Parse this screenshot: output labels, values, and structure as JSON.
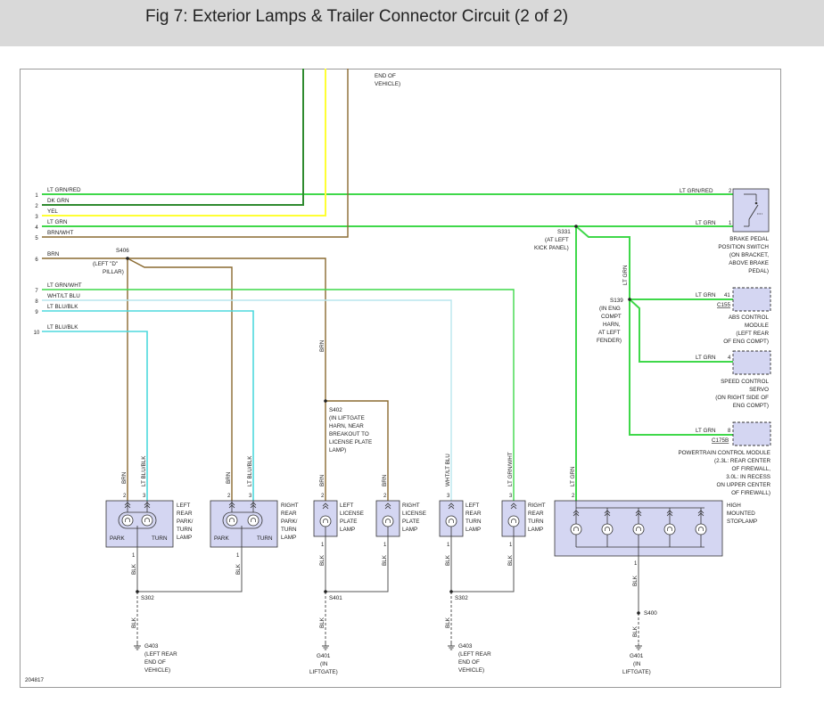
{
  "title": "Fig 7: Exterior Lamps & Trailer Connector Circuit (2 of 2)",
  "figure_number": "204817",
  "colors": {
    "lt_grn": "#3fd84a",
    "dk_grn": "#2f8a2f",
    "yel": "#ffff33",
    "brn": "#8a6a30",
    "lt_blu": "#4ed8de",
    "wht_lt_blu": "#b9e6ee",
    "box_fill": "#d4d6f2"
  },
  "top_note": {
    "line1": "END OF",
    "line2": "VEHICLE)"
  },
  "wires": [
    {
      "pin": "1",
      "color": "LT GRN/RED"
    },
    {
      "pin": "2",
      "color": "DK GRN"
    },
    {
      "pin": "3",
      "color": "YEL"
    },
    {
      "pin": "4",
      "color": "LT GRN"
    },
    {
      "pin": "5",
      "color": "BRN/WHT"
    },
    {
      "pin": "6",
      "color": "BRN"
    },
    {
      "pin": "7",
      "color": "LT GRN/WHT"
    },
    {
      "pin": "8",
      "color": "WHT/LT BLU"
    },
    {
      "pin": "9",
      "color": "LT BLU/BLK"
    },
    {
      "pin": "10",
      "color": "LT BLU/BLK"
    }
  ],
  "splices": {
    "s406": {
      "name": "S406",
      "l1": "(LEFT \"D\"",
      "l2": "PILLAR)"
    },
    "s331": {
      "name": "S331",
      "l1": "(AT LEFT",
      "l2": "KICK PANEL)"
    },
    "s139": {
      "name": "S139",
      "l1": "(IN ENG",
      "l2": "COMPT",
      "l3": "HARN,",
      "l4": "AT LEFT",
      "l5": "FENDER)"
    },
    "s402": {
      "name": "S402",
      "l1": "(IN LIFTGATE",
      "l2": "HARN, NEAR",
      "l3": "BREAKOUT TO",
      "l4": "LICENSE PLATE",
      "l5": "LAMP)"
    },
    "s302a": "S302",
    "s302b": "S302",
    "s401": "S401",
    "s400": "S400"
  },
  "brake_switch": {
    "wire1": "LT GRN/RED",
    "pin1": "2",
    "wire2": "LT GRN",
    "pin2": "1",
    "l1": "BRAKE PEDAL",
    "l2": "POSITION SWITCH",
    "l3": "(ON BRACKET,",
    "l4": "ABOVE BRAKE",
    "l5": "PEDAL)"
  },
  "abs": {
    "wire": "LT GRN",
    "pin": "41",
    "conn": "C155",
    "l1": "ABS CONTROL",
    "l2": "MODULE",
    "l3": "(LEFT REAR",
    "l4": "OF ENG COMPT)"
  },
  "speed": {
    "wire": "LT GRN",
    "pin": "4",
    "l1": "SPEED CONTROL",
    "l2": "SERVO",
    "l3": "(ON RIGHT SIDE OF",
    "l4": "ENG COMPT)"
  },
  "pcm": {
    "wire": "LT GRN",
    "pin": "8",
    "conn": "C175B",
    "l1": "POWERTRAIN CONTROL MODULE",
    "l2": "(2.3L: REAR CENTER",
    "l3": "OF FIREWALL,",
    "l4": "3.0L: IN RECESS",
    "l5": "ON UPPER CENTER",
    "l6": "OF FIREWALL)"
  },
  "vert_labels": {
    "lt_grn": "LT GRN",
    "brn": "BRN",
    "brn1": "BRN",
    "ltblublk1": "LT BLU/BLK",
    "brn2": "BRN",
    "ltblublk2": "LT BLU/BLK",
    "brn3": "BRN",
    "brn4": "BRN",
    "wht_lt_blu": "WHT/LT BLU",
    "lt_grn_wht": "LT GRN/WHT",
    "lt_grn2": "LT GRN",
    "blk": "BLK"
  },
  "lamps": {
    "lrp": {
      "l1": "LEFT",
      "l2": "REAR",
      "l3": "PARK/",
      "l4": "TURN",
      "l5": "LAMP",
      "park": "PARK",
      "turn": "TURN"
    },
    "rrp": {
      "l1": "RIGHT",
      "l2": "REAR",
      "l3": "PARK/",
      "l4": "TURN",
      "l5": "LAMP",
      "park": "PARK",
      "turn": "TURN"
    },
    "llp": {
      "l1": "LEFT",
      "l2": "LICENSE",
      "l3": "PLATE",
      "l4": "LAMP"
    },
    "rlp": {
      "l1": "RIGHT",
      "l2": "LICENSE",
      "l3": "PLATE",
      "l4": "LAMP"
    },
    "lrt": {
      "l1": "LEFT",
      "l2": "REAR",
      "l3": "TURN",
      "l4": "LAMP"
    },
    "rrt": {
      "l1": "RIGHT",
      "l2": "REAR",
      "l3": "TURN",
      "l4": "LAMP"
    },
    "hms": {
      "l1": "HIGH",
      "l2": "MOUNTED",
      "l3": "STOPLAMP"
    }
  },
  "grounds": {
    "g403a": {
      "name": "G403",
      "l1": "(LEFT REAR",
      "l2": "END OF",
      "l3": "VEHICLE)"
    },
    "g401a": {
      "name": "G401",
      "l1": "(IN",
      "l2": "LIFTGATE)"
    },
    "g403b": {
      "name": "G403",
      "l1": "(LEFT REAR",
      "l2": "END OF",
      "l3": "VEHICLE)"
    },
    "g401b": {
      "name": "G401",
      "l1": "(IN",
      "l2": "LIFTGATE)"
    }
  }
}
